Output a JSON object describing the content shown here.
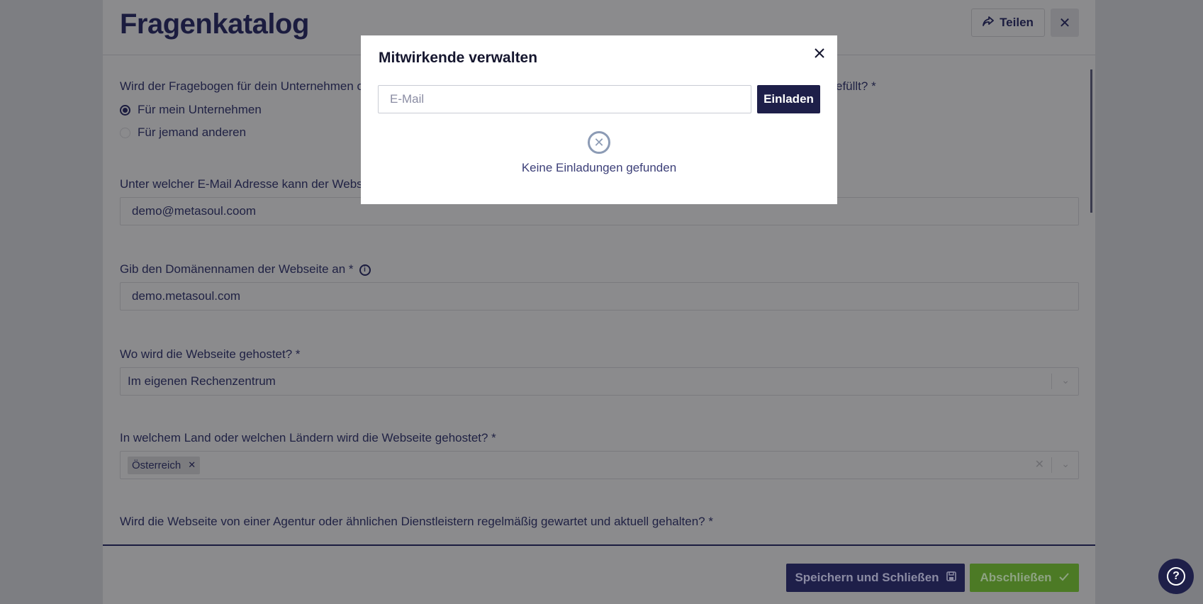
{
  "header": {
    "title": "Fragenkatalog",
    "share_label": "Teilen",
    "close_symbol": "✕"
  },
  "form": {
    "q1": {
      "label": "Wird der Fragebogen für dein Unternehmen o",
      "label_tail": "efüllt? *",
      "options": [
        "Für mein Unternehmen",
        "Für jemand anderen"
      ],
      "selected": "Für mein Unternehmen"
    },
    "q2": {
      "label": "Unter welcher E-Mail Adresse kann der Webs",
      "value": "demo@metasoul.coom"
    },
    "q3": {
      "label": "Gib den Domänennamen der Webseite an *",
      "value": "demo.metasoul.com"
    },
    "q4": {
      "label": "Wo wird die Webseite gehostet? *",
      "value": "Im eigenen Rechenzentrum"
    },
    "q5": {
      "label": "In welchem Land oder welchen Ländern wird die Webseite gehostet? *",
      "chips": [
        "Österreich"
      ]
    },
    "q6": {
      "label": "Wird die Webseite von einer Agentur oder ähnlichen Dienstleistern regelmäßig gewartet und aktuell gehalten? *"
    }
  },
  "footer": {
    "save_label": "Speichern und Schließen",
    "finish_label": "Abschließen"
  },
  "help": {
    "symbol": "?"
  },
  "modal": {
    "title": "Mitwirkende verwalten",
    "email_placeholder": "E-Mail",
    "email_value": "",
    "invite_label": "Einladen",
    "empty_text": "Keine Einladungen gefunden"
  },
  "colors": {
    "primary": "#1e1f49",
    "success": "#4c7a25",
    "empty_icon": "#8c9bb5"
  },
  "icons": [
    "share-icon",
    "close-icon",
    "info-icon",
    "chevron-down-icon",
    "save-icon",
    "check-icon",
    "help-icon",
    "empty-circle-x-icon"
  ]
}
